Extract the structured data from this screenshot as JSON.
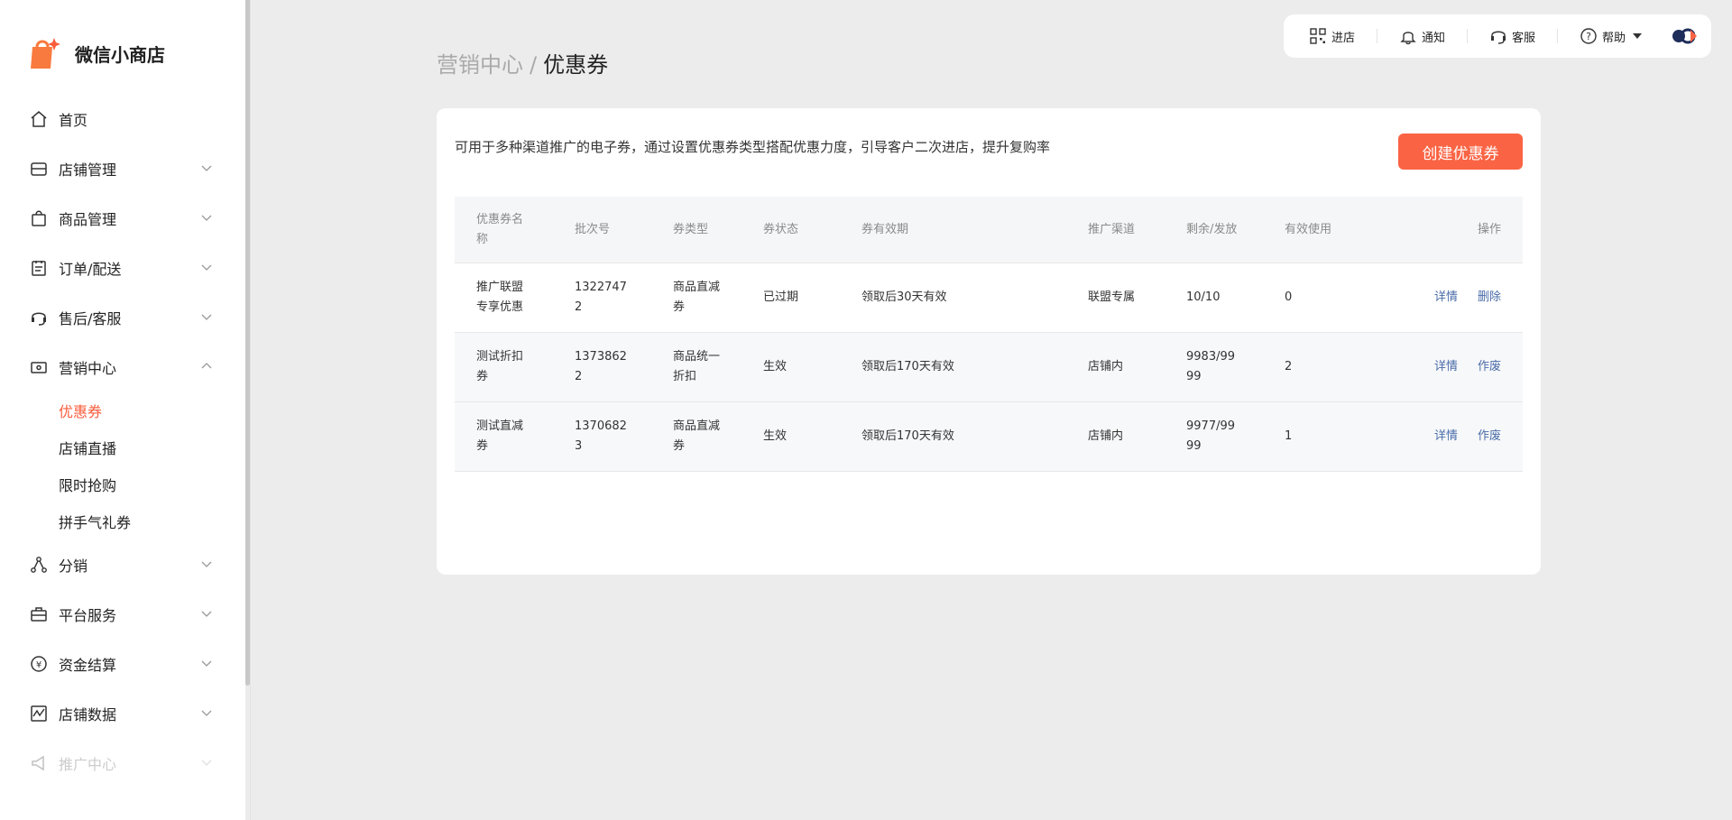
{
  "brand": {
    "name": "微信小商店"
  },
  "sidebar": {
    "items": [
      {
        "label": "首页",
        "icon": "home-icon",
        "expandable": false
      },
      {
        "label": "店铺管理",
        "icon": "store-icon",
        "expandable": true
      },
      {
        "label": "商品管理",
        "icon": "shopping-bag-icon",
        "expandable": true
      },
      {
        "label": "订单/配送",
        "icon": "clipboard-icon",
        "expandable": true
      },
      {
        "label": "售后/客服",
        "icon": "headset-icon",
        "expandable": true
      },
      {
        "label": "营销中心",
        "icon": "ticket-icon",
        "expandable": true,
        "expanded": true
      },
      {
        "label": "分销",
        "icon": "share-nodes-icon",
        "expandable": true
      },
      {
        "label": "平台服务",
        "icon": "briefcase-icon",
        "expandable": true
      },
      {
        "label": "资金结算",
        "icon": "yuan-coin-icon",
        "expandable": true
      },
      {
        "label": "店铺数据",
        "icon": "chart-icon",
        "expandable": true
      },
      {
        "label": "推广中心",
        "icon": "megaphone-icon",
        "expandable": true
      }
    ],
    "marketing_sub": [
      {
        "label": "优惠券",
        "active": true
      },
      {
        "label": "店铺直播",
        "active": false
      },
      {
        "label": "限时抢购",
        "active": false
      },
      {
        "label": "拼手气礼券",
        "active": false
      }
    ]
  },
  "topbar": {
    "enter_store": "进店",
    "notify": "通知",
    "service": "客服",
    "help": "帮助"
  },
  "breadcrumb": {
    "parent": "营销中心",
    "separator": "/",
    "current": "优惠券"
  },
  "card": {
    "description": "可用于多种渠道推广的电子券，通过设置优惠券类型搭配优惠力度，引导客户二次进店，提升复购率",
    "create_button": "创建优惠券"
  },
  "table": {
    "headers": [
      "优惠券名称",
      "批次号",
      "券类型",
      "券状态",
      "券有效期",
      "推广渠道",
      "剩余/发放",
      "有效使用",
      "操作"
    ],
    "rows": [
      {
        "name": "推广联盟专享优惠",
        "batch": "13227472",
        "type": "商品直减券",
        "status": "已过期",
        "validity": "领取后30天有效",
        "channel": "联盟专属",
        "remaining": "10/10",
        "used": "0",
        "action_detail": "详情",
        "action_other": "删除"
      },
      {
        "name": "测试折扣券",
        "batch": "13738622",
        "type": "商品统一折扣",
        "status": "生效",
        "validity": "领取后170天有效",
        "channel": "店铺内",
        "remaining": "9983/9999",
        "used": "2",
        "action_detail": "详情",
        "action_other": "作废"
      },
      {
        "name": "测试直减券",
        "batch": "13706823",
        "type": "商品直减券",
        "status": "生效",
        "validity": "领取后170天有效",
        "channel": "店铺内",
        "remaining": "9977/9999",
        "used": "1",
        "action_detail": "详情",
        "action_other": "作废"
      }
    ]
  },
  "colors": {
    "accent": "#fa6444",
    "active_menu": "#fa5c3c",
    "link": "#4a6ca8",
    "background": "#ececec"
  }
}
